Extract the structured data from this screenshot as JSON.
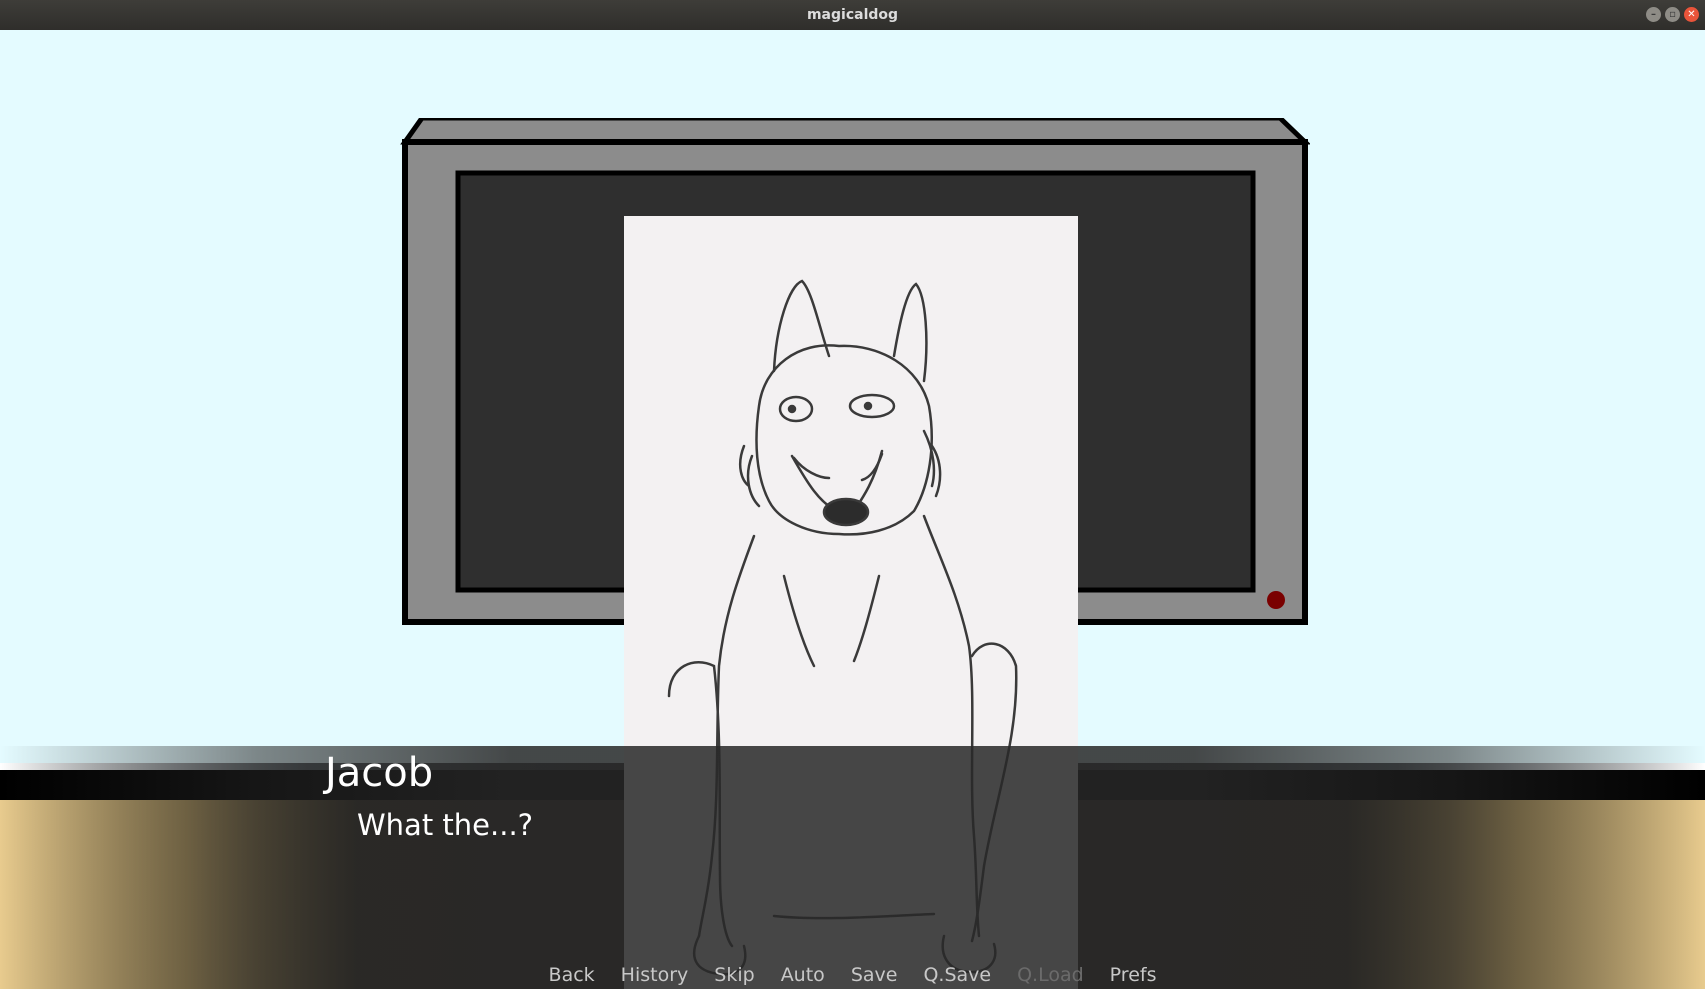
{
  "window": {
    "title": "magicaldog",
    "controls": {
      "minimize_icon": "minimize-icon",
      "maximize_icon": "maximize-icon",
      "close_icon": "close-icon"
    }
  },
  "scene": {
    "wall_color": "#e4fbff",
    "tv_power_light_color": "#7a0000"
  },
  "dialogue": {
    "speaker": "Jacob",
    "text": "What the...?"
  },
  "quick_menu": {
    "items": [
      {
        "label": "Back",
        "enabled": true
      },
      {
        "label": "History",
        "enabled": true
      },
      {
        "label": "Skip",
        "enabled": true
      },
      {
        "label": "Auto",
        "enabled": true
      },
      {
        "label": "Save",
        "enabled": true
      },
      {
        "label": "Q.Save",
        "enabled": true
      },
      {
        "label": "Q.Load",
        "enabled": false
      },
      {
        "label": "Prefs",
        "enabled": true
      }
    ]
  }
}
